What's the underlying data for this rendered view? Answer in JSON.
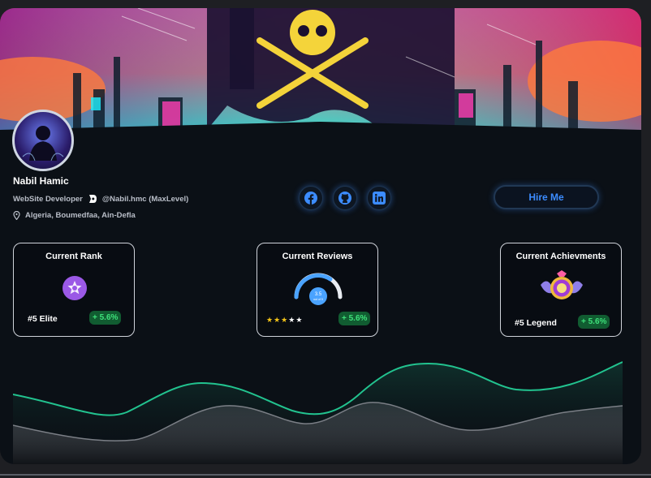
{
  "profile": {
    "name": "Nabil Hamic",
    "role": "WebSite Developer",
    "handle": "@Nabil.hmc (MaxLevel)",
    "location": "Algeria, Boumedfaa, Ain-Defla"
  },
  "socials": [
    {
      "name": "facebook-icon"
    },
    {
      "name": "github-icon"
    },
    {
      "name": "linkedin-icon"
    }
  ],
  "hire_label": "Hire Me",
  "stats": [
    {
      "title": "Current Rank",
      "label": "#5 Elite",
      "change": "+ 5.6%"
    },
    {
      "title": "Current Reviews",
      "label": "",
      "change": "+ 5.6%",
      "gauge_value": "3.5",
      "gauge_sub": "out of 5",
      "stars": 3.5
    },
    {
      "title": "Current Achievments",
      "label": "#5 Legend",
      "change": "+ 5.6%"
    }
  ],
  "colors": {
    "accent": "#3c8cff",
    "positive": "#3ee07a",
    "positive_bg": "#115c31",
    "line_primary": "#22c38f",
    "line_secondary": "#7b7f86"
  }
}
